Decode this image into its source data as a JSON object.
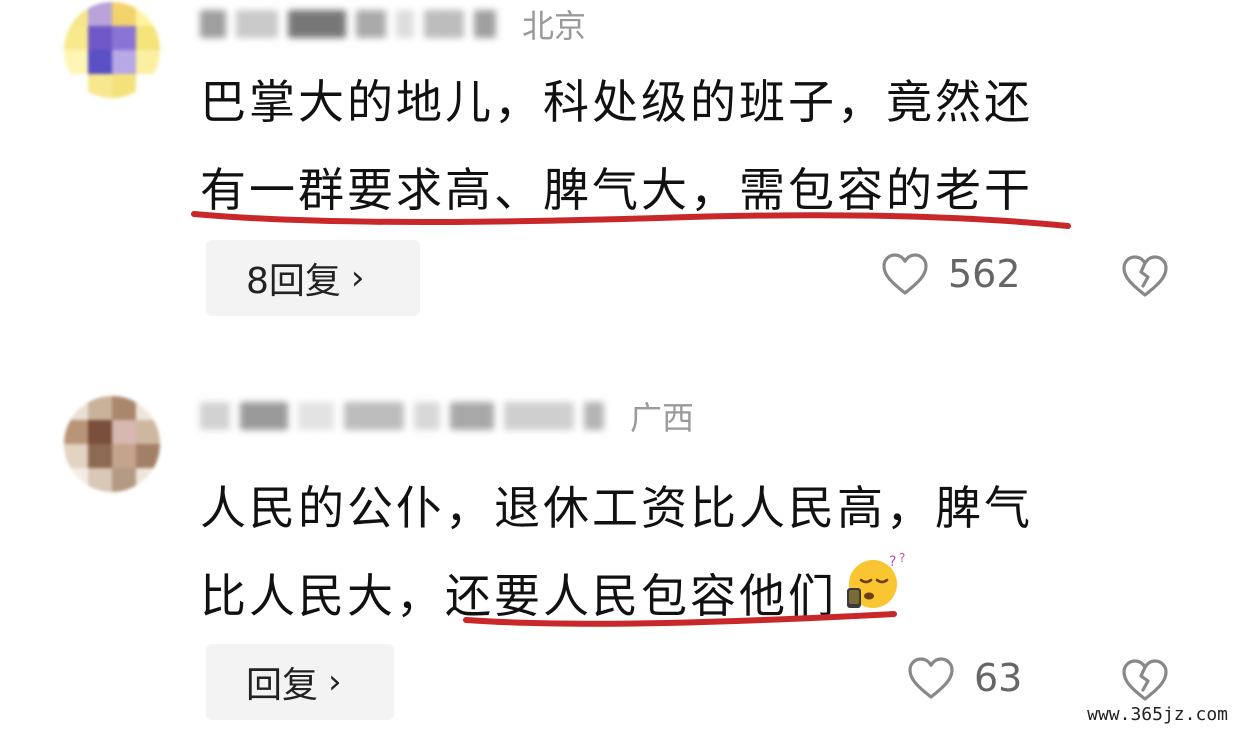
{
  "comments": [
    {
      "location": "北京",
      "lines": [
        "巴掌大的地儿，科处级的班子，竟然还",
        "有一群要求高、脾气大，需包容的老干"
      ],
      "reply_label": "8回复",
      "likes": "562",
      "icons": {
        "like": "heart-outline-icon",
        "dislike": "broken-heart-icon",
        "chevron": "chevron-right-icon"
      }
    },
    {
      "location": "广西",
      "lines": [
        "人民的公仆，退休工资比人民高，脾气",
        "比人民大，还要人民包容他们"
      ],
      "emoji": "sleepy-dizzy-emoji",
      "reply_label": "回复",
      "likes": "63",
      "icons": {
        "like": "heart-outline-icon",
        "dislike": "broken-heart-icon",
        "chevron": "chevron-right-icon"
      }
    }
  ],
  "colors": {
    "underline": "#c8282a",
    "location_text": "#9a9a9a",
    "reply_bg": "#f3f3f3",
    "icon_gray": "#888888"
  },
  "watermark": "www.365jz.com"
}
